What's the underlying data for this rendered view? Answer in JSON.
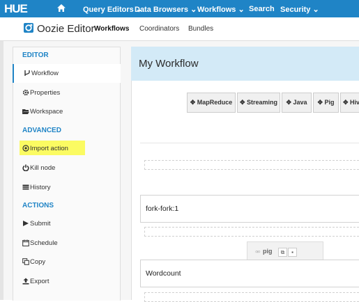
{
  "topnav": {
    "logo": "HUE",
    "items": [
      {
        "label": "Query Editors ⌄"
      },
      {
        "label": "Data Browsers ⌄"
      },
      {
        "label": "Workflows ⌄"
      },
      {
        "label": "Search"
      },
      {
        "label": "Security ⌄"
      }
    ]
  },
  "subnav": {
    "app_title": "Oozie Editor",
    "tabs": [
      {
        "label": "Workflows",
        "active": true
      },
      {
        "label": "Coordinators",
        "active": false
      },
      {
        "label": "Bundles",
        "active": false
      }
    ]
  },
  "sidebar": {
    "sections": [
      {
        "title": "EDITOR",
        "items": [
          {
            "label": "Workflow",
            "icon": "code-fork-icon",
            "active": true
          },
          {
            "label": "Properties",
            "icon": "gear-icon"
          },
          {
            "label": "Workspace",
            "icon": "folder-open-icon"
          }
        ]
      },
      {
        "title": "ADVANCED",
        "items": [
          {
            "label": "Import action",
            "icon": "import-circle-icon",
            "highlighted": true
          },
          {
            "label": "Kill node",
            "icon": "power-off-icon"
          },
          {
            "label": "History",
            "icon": "table-icon"
          }
        ]
      },
      {
        "title": "ACTIONS",
        "items": [
          {
            "label": "Submit",
            "icon": "play-icon"
          },
          {
            "label": "Schedule",
            "icon": "calendar-icon"
          },
          {
            "label": "Copy",
            "icon": "copy-icon"
          },
          {
            "label": "Export",
            "icon": "upload-icon"
          }
        ]
      }
    ]
  },
  "workflow": {
    "title": "My Workflow",
    "action_buttons": [
      {
        "label": "MapReduce"
      },
      {
        "label": "Streaming"
      },
      {
        "label": "Java"
      },
      {
        "label": "Pig"
      },
      {
        "label": "Hiv"
      }
    ],
    "nodes": [
      {
        "label": "fork-fork:1"
      },
      {
        "label": "Wordcount"
      }
    ],
    "pig_tab": {
      "label": "pig"
    }
  },
  "colors": {
    "accent": "#1f84c6",
    "header_bg": "#d3eaf7",
    "highlight": "#fbfb62"
  }
}
